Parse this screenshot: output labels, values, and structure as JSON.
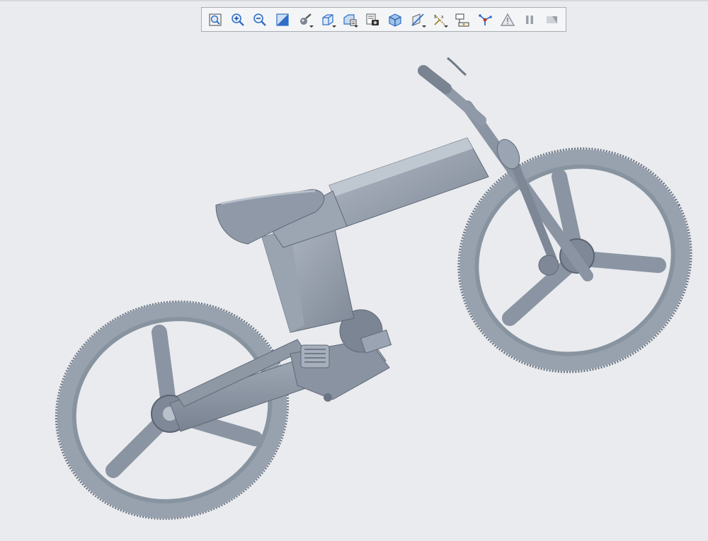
{
  "window": {
    "title": ""
  },
  "toolbar": {
    "buttons": [
      {
        "icon": "refit-icon",
        "tooltip": ""
      },
      {
        "icon": "zoom-in-icon",
        "tooltip": ""
      },
      {
        "icon": "zoom-out-icon",
        "tooltip": ""
      },
      {
        "icon": "repaint-icon",
        "tooltip": ""
      },
      {
        "icon": "display-style-icon",
        "tooltip": ""
      },
      {
        "icon": "saved-orientation-icon",
        "tooltip": ""
      },
      {
        "icon": "view-manager-icon",
        "tooltip": ""
      },
      {
        "icon": "saved-views-icon",
        "tooltip": ""
      },
      {
        "icon": "perspective-view-icon",
        "tooltip": ""
      },
      {
        "icon": "section-icon",
        "tooltip": ""
      },
      {
        "icon": "datum-display-icon",
        "tooltip": ""
      },
      {
        "icon": "annotation-display-icon",
        "tooltip": ""
      },
      {
        "icon": "spin-center-icon",
        "tooltip": ""
      },
      {
        "icon": "warning-filter-icon",
        "tooltip": ""
      },
      {
        "icon": "pause-icon",
        "tooltip": ""
      },
      {
        "icon": "next-step-icon",
        "tooltip": ""
      }
    ]
  },
  "model": {
    "name": "",
    "shade_color": "#9aa4b2",
    "edge_color": "#5f6977"
  },
  "colors": {
    "background": "#e9ebee",
    "toolbar_bg": "#f4f5f7",
    "accent_blue": "#2f6fc7"
  }
}
